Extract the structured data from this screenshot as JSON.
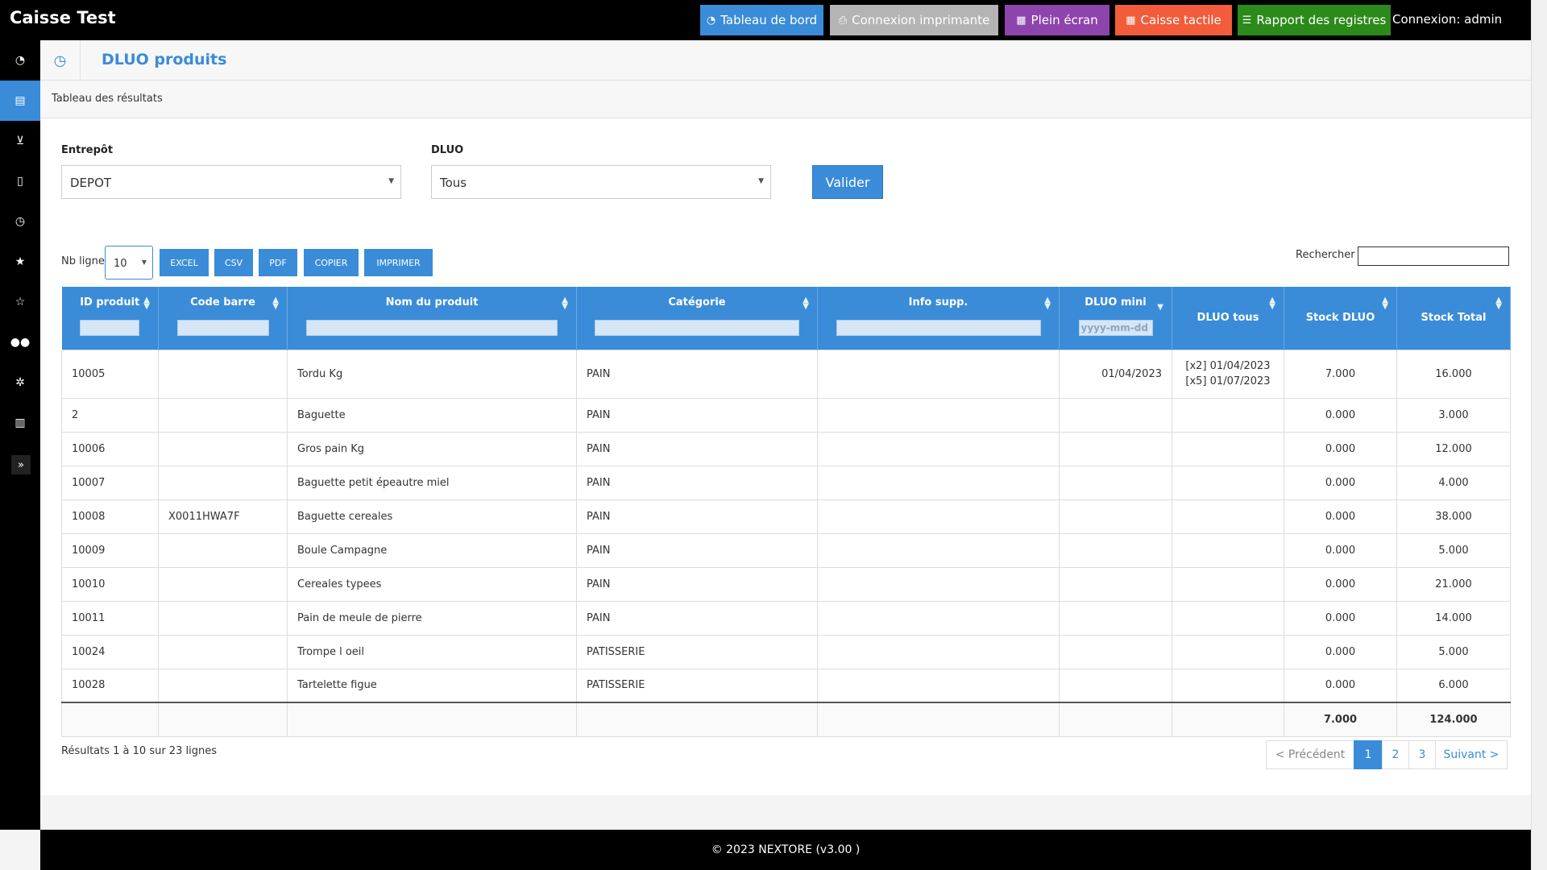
{
  "app": {
    "title": "Caisse Test",
    "login": "Connexion: admin"
  },
  "topbar": {
    "buttons": [
      {
        "label": "Tableau de bord",
        "icon": "dashboard-icon",
        "color": "#3a8cd8"
      },
      {
        "label": "Connexion imprimante",
        "icon": "printer-icon",
        "color": "#b4b4b4"
      },
      {
        "label": "Plein écran",
        "icon": "grid-icon",
        "color": "#8e44ad"
      },
      {
        "label": "Caisse tactile",
        "icon": "grid-icon",
        "color": "#f25c3b"
      },
      {
        "label": "Rapport des registres",
        "icon": "list-icon",
        "color": "#2c8a1a"
      }
    ]
  },
  "page": {
    "title": "DLUO produits",
    "subtitle": "Tableau des résultats"
  },
  "filters": {
    "entrepot_label": "Entrepôt",
    "entrepot_value": "DEPOT",
    "dluo_label": "DLUO",
    "dluo_value": "Tous",
    "submit_label": "Valider"
  },
  "toolbar": {
    "nb_ligne_label": "Nb ligne",
    "nb_ligne_value": "10",
    "export_buttons": [
      "EXCEL",
      "CSV",
      "PDF",
      "COPIER",
      "IMPRIMER"
    ],
    "search_label": "Rechercher"
  },
  "table": {
    "columns": [
      "ID produit",
      "Code barre",
      "Nom du produit",
      "Catégorie",
      "Info supp.",
      "DLUO mini",
      "DLUO tous",
      "Stock DLUO",
      "Stock Total"
    ],
    "date_placeholder": "yyyy-mm-dd",
    "rows": [
      {
        "id": "10005",
        "code": "",
        "nom": "Tordu Kg",
        "cat": "PAIN",
        "info": "",
        "mini": "01/04/2023",
        "tous1": "[x2] 01/04/2023",
        "tous2": "[x5] 01/07/2023",
        "sdluo": "7.000",
        "stotal": "16.000"
      },
      {
        "id": "2",
        "code": "",
        "nom": "Baguette",
        "cat": "PAIN",
        "info": "",
        "mini": "",
        "tous1": "",
        "tous2": "",
        "sdluo": "0.000",
        "stotal": "3.000"
      },
      {
        "id": "10006",
        "code": "",
        "nom": "Gros pain Kg",
        "cat": "PAIN",
        "info": "",
        "mini": "",
        "tous1": "",
        "tous2": "",
        "sdluo": "0.000",
        "stotal": "12.000"
      },
      {
        "id": "10007",
        "code": "",
        "nom": "Baguette petit épeautre miel",
        "cat": "PAIN",
        "info": "",
        "mini": "",
        "tous1": "",
        "tous2": "",
        "sdluo": "0.000",
        "stotal": "4.000"
      },
      {
        "id": "10008",
        "code": "X0011HWA7F",
        "nom": "Baguette cereales",
        "cat": "PAIN",
        "info": "",
        "mini": "",
        "tous1": "",
        "tous2": "",
        "sdluo": "0.000",
        "stotal": "38.000"
      },
      {
        "id": "10009",
        "code": "",
        "nom": "Boule Campagne",
        "cat": "PAIN",
        "info": "",
        "mini": "",
        "tous1": "",
        "tous2": "",
        "sdluo": "0.000",
        "stotal": "5.000"
      },
      {
        "id": "10010",
        "code": "",
        "nom": "Cereales typees",
        "cat": "PAIN",
        "info": "",
        "mini": "",
        "tous1": "",
        "tous2": "",
        "sdluo": "0.000",
        "stotal": "21.000"
      },
      {
        "id": "10011",
        "code": "",
        "nom": "Pain de meule de pierre",
        "cat": "PAIN",
        "info": "",
        "mini": "",
        "tous1": "",
        "tous2": "",
        "sdluo": "0.000",
        "stotal": "14.000"
      },
      {
        "id": "10024",
        "code": "",
        "nom": "Trompe l oeil",
        "cat": "PATISSERIE",
        "info": "",
        "mini": "",
        "tous1": "",
        "tous2": "",
        "sdluo": "0.000",
        "stotal": "5.000"
      },
      {
        "id": "10028",
        "code": "",
        "nom": "Tartelette figue",
        "cat": "PATISSERIE",
        "info": "",
        "mini": "",
        "tous1": "",
        "tous2": "",
        "sdluo": "0.000",
        "stotal": "6.000"
      }
    ],
    "totals": {
      "sdluo": "7.000",
      "stotal": "124.000"
    }
  },
  "pagination": {
    "summary": "Résultats 1 à 10 sur 23 lignes",
    "prev": "< Précédent",
    "pages": [
      "1",
      "2",
      "3"
    ],
    "active": "1",
    "next": "Suivant >"
  },
  "footer": {
    "text": "© 2023 NEXTORE (v3.00 )"
  },
  "sidebar": {
    "icons": [
      "dashboard-icon",
      "table-icon",
      "cart-icon",
      "document-icon",
      "clock-icon",
      "star-icon",
      "star-outline-icon",
      "users-icon",
      "gear-icon",
      "chart-icon"
    ],
    "active_index": 1
  },
  "colors": {
    "accent": "#3a8cd8",
    "topbar": "#000000"
  }
}
